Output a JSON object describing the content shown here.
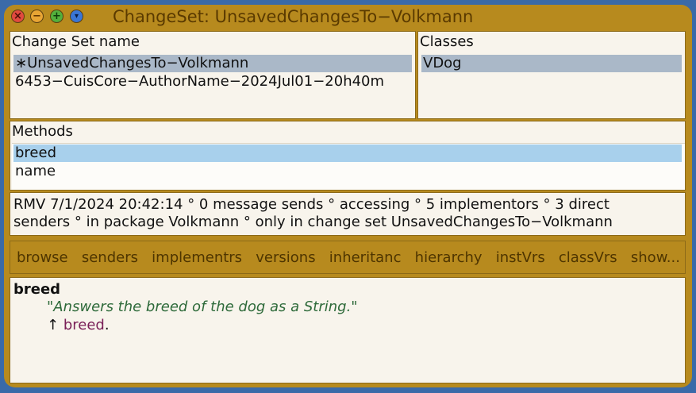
{
  "window": {
    "title": "ChangeSet: UnsavedChangesTo−Volkmann",
    "controls": {
      "close": "×",
      "minimize": "−",
      "maximize": "+",
      "menu": "▾"
    }
  },
  "change_sets": {
    "title": "Change Set name",
    "items": [
      {
        "label": "∗UnsavedChangesTo−Volkmann",
        "selected": true
      },
      {
        "label": "6453−CuisCore−AuthorName−2024Jul01−20h40m",
        "selected": false
      }
    ]
  },
  "classes": {
    "title": "Classes",
    "items": [
      {
        "label": "VDog",
        "selected": true
      }
    ]
  },
  "methods": {
    "title": "Methods",
    "items": [
      {
        "label": "breed",
        "selected": true
      },
      {
        "label": "name",
        "selected": false
      }
    ]
  },
  "info": {
    "line1": "RMV 7/1/2024 20:42:14 ° 0 message sends ° accessing ° 5 implementors ° 3 direct",
    "line2": "senders ° in package Volkmann ° only in change set UnsavedChangesTo−Volkmann"
  },
  "toolbar": {
    "browse": "browse",
    "senders": "senders",
    "implementors": "implementrs",
    "versions": "versions",
    "inheritance": "inheritanc",
    "hierarchy": "hierarchy",
    "inst_vars": "instVrs",
    "class_vars": "classVrs",
    "show": "show..."
  },
  "code": {
    "method_name": "breed",
    "comment": "\"Answers the breed of the dog as a String.\"",
    "return_arrow": "↑",
    "return_var": "breed",
    "terminator": "."
  }
}
